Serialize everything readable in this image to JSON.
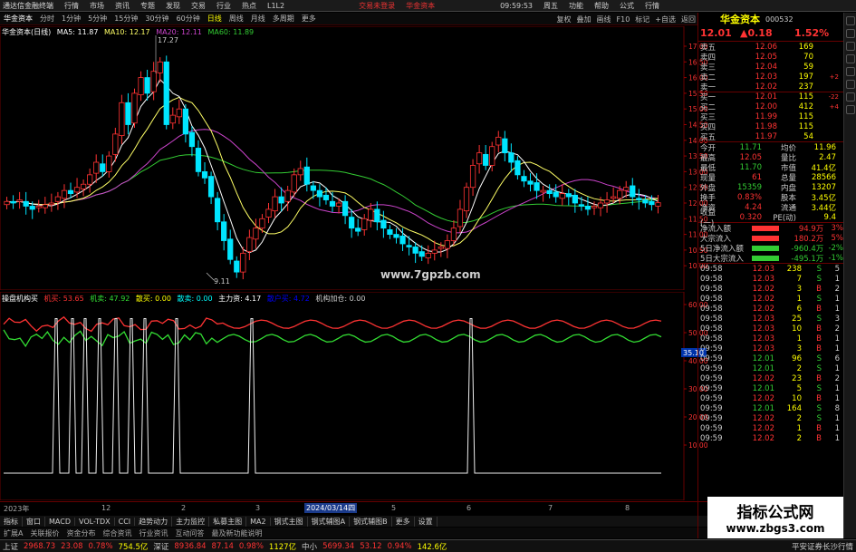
{
  "menubar": {
    "app": "通达信金融终端",
    "items": [
      "行情",
      "市场",
      "资讯",
      "专题",
      "发现",
      "交易",
      "行业",
      "热点",
      "L1L2"
    ],
    "right_red": [
      "交易未登录",
      "华金资本"
    ],
    "right": [
      "功能",
      "帮助",
      "公式",
      "行情"
    ],
    "time": "09:59:53",
    "day": "周五"
  },
  "toolbar": {
    "name": "华金资本",
    "periods": [
      "分时",
      "1分钟",
      "5分钟",
      "15分钟",
      "30分钟",
      "60分钟",
      "日线",
      "周线",
      "月线",
      "多周期",
      "更多"
    ],
    "active_period": "日线",
    "right": [
      "复权",
      "叠加",
      "画线",
      "F10",
      "标记",
      "+自选",
      "返回"
    ]
  },
  "main": {
    "title": "华金资本(日线)",
    "ma5": "MA5: 11.87",
    "ma10": "MA10: 12.17",
    "ma20": "MA20: 12.11",
    "ma60": "MA60: 11.89",
    "high_label": "17.27",
    "low_label": "9.11",
    "watermark": "www.7gpzb.com",
    "yaxis": [
      "17.00",
      "16.50",
      "16.00",
      "15.50",
      "15.00",
      "14.50",
      "14.00",
      "13.50",
      "13.00",
      "12.50",
      "12.00",
      "11.50",
      "11.00",
      "10.50",
      "10.00"
    ]
  },
  "indicator": {
    "title": "操盘机构买",
    "l1": "机买: 53.65",
    "l2": "机卖: 47.92",
    "l3": "散买: 0.00",
    "l4": "散卖: 0.00",
    "l5": "主力资: 4.17",
    "l6": "散户买: 4.72",
    "l7": "机构加仓: 0.00",
    "yaxis": [
      "60.00",
      "50.00",
      "40.00",
      "30.00",
      "20.00",
      "10.00"
    ],
    "marker": "35.10"
  },
  "xaxis": {
    "labels": [
      "2023年",
      "12",
      "2",
      "3",
      "2024/03/14四",
      "5",
      "6",
      "7",
      "8"
    ]
  },
  "tabs": [
    "指标",
    "窗口",
    "MACD",
    "VOL-TDX",
    "CCI",
    "趋势动力",
    "主力监控",
    "私募主图",
    "MA2",
    "钢式主图",
    "钢式辅图A",
    "钢式辅图B",
    "更多",
    "设置"
  ],
  "subtabs": [
    "扩展A",
    "关联报价",
    "资金分布",
    "综合资讯",
    "行业资讯",
    "互动问答",
    "最及新功能说明"
  ],
  "status": {
    "sh_label": "上证",
    "sh": "2968.73",
    "sh_ch": "23.08",
    "sh_pct": "0.78%",
    "sh_amt": "754.5亿",
    "sz_label": "深证",
    "sz": "8936.84",
    "sz_ch": "87.14",
    "sz_pct": "0.98%",
    "sz_amt": "1127亿",
    "zx_label": "中小",
    "zx": "5699.34",
    "zx_ch": "53.12",
    "zx_pct": "0.94%",
    "zx_amt": "142.6亿",
    "right": "平安证券长沙行情"
  },
  "quote": {
    "name": "华金资本",
    "code": "000532",
    "price": "12.01",
    "change": "▲0.18",
    "pct": "1.52%"
  },
  "orderbook": [
    {
      "label": "卖五",
      "price": "12.06",
      "vol": "169",
      "x": ""
    },
    {
      "label": "卖四",
      "price": "12.05",
      "vol": "70",
      "x": ""
    },
    {
      "label": "卖三",
      "price": "12.04",
      "vol": "59",
      "x": ""
    },
    {
      "label": "卖二",
      "price": "12.03",
      "vol": "197",
      "x": "+2"
    },
    {
      "label": "卖一",
      "price": "12.02",
      "vol": "237",
      "x": ""
    },
    {
      "label": "买一",
      "price": "12.01",
      "vol": "115",
      "x": "-22"
    },
    {
      "label": "买二",
      "price": "12.00",
      "vol": "412",
      "x": "+4"
    },
    {
      "label": "买三",
      "price": "11.99",
      "vol": "115",
      "x": ""
    },
    {
      "label": "买四",
      "price": "11.98",
      "vol": "115",
      "x": ""
    },
    {
      "label": "买五",
      "price": "11.97",
      "vol": "54",
      "x": ""
    }
  ],
  "stats": [
    {
      "l1": "今开",
      "v1": "11.71",
      "l2": "均价",
      "v2": "11.96"
    },
    {
      "l1": "最高",
      "v1": "12.05",
      "l2": "量比",
      "v2": "2.47"
    },
    {
      "l1": "最低",
      "v1": "11.70",
      "l2": "市值",
      "v2": "41.4亿"
    },
    {
      "l1": "现量",
      "v1": "61",
      "l2": "总量",
      "v2": "28566"
    },
    {
      "l1": "外盘",
      "v1": "15359",
      "l2": "内盘",
      "v2": "13207"
    },
    {
      "l1": "换手",
      "v1": "0.83%",
      "l2": "股本",
      "v2": "3.45亿"
    },
    {
      "l1": "净资",
      "v1": "4.24",
      "l2": "流通",
      "v2": "3.44亿"
    },
    {
      "l1": "收益(一)",
      "v1": "0.320",
      "l2": "PE(动)",
      "v2": "9.4"
    }
  ],
  "flows": [
    {
      "label": "净流入额",
      "value": "94.9万",
      "pct": "3%"
    },
    {
      "label": "大宗流入",
      "value": "180.2万",
      "pct": "5%"
    },
    {
      "label": "5日净流入额",
      "value": "-960.4万",
      "pct": "-2%"
    },
    {
      "label": "5日大宗流入",
      "value": "-495.1万",
      "pct": "-1%"
    }
  ],
  "ticks": [
    [
      "09:58",
      "12.03",
      "238",
      "S",
      "5"
    ],
    [
      "09:58",
      "12.03",
      "7",
      "S",
      "1"
    ],
    [
      "09:58",
      "12.02",
      "3",
      "B",
      "2"
    ],
    [
      "09:58",
      "12.02",
      "1",
      "S",
      "1"
    ],
    [
      "09:58",
      "12.02",
      "6",
      "B",
      "1"
    ],
    [
      "09:58",
      "12.03",
      "25",
      "S",
      "3"
    ],
    [
      "09:58",
      "12.03",
      "10",
      "B",
      "2"
    ],
    [
      "09:58",
      "12.03",
      "1",
      "B",
      "1"
    ],
    [
      "09:59",
      "12.03",
      "3",
      "B",
      "1"
    ],
    [
      "09:59",
      "12.01",
      "96",
      "S",
      "6"
    ],
    [
      "09:59",
      "12.01",
      "2",
      "S",
      "1"
    ],
    [
      "09:59",
      "12.02",
      "23",
      "B",
      "2"
    ],
    [
      "09:59",
      "12.01",
      "5",
      "S",
      "1"
    ],
    [
      "09:59",
      "12.02",
      "10",
      "B",
      "1"
    ],
    [
      "09:59",
      "12.01",
      "164",
      "S",
      "8"
    ],
    [
      "09:59",
      "12.02",
      "2",
      "S",
      "1"
    ],
    [
      "09:59",
      "12.02",
      "1",
      "B",
      "1"
    ],
    [
      "09:59",
      "12.02",
      "2",
      "B",
      "1"
    ]
  ],
  "watermark": {
    "line1": "指标公式网",
    "line2": "www.zbgs3.com"
  },
  "colors": {
    "up": "#ff3333",
    "down": "#00e5ff",
    "ma5": "#ffffff",
    "ma10": "#ffff66",
    "ma20": "#cc44cc",
    "ma60": "#33cc33"
  },
  "chart_data": {
    "type": "line",
    "title": "操盘机构买",
    "series": [
      {
        "name": "机买",
        "values": [
          53.65
        ]
      },
      {
        "name": "机卖",
        "values": [
          47.92
        ]
      },
      {
        "name": "散买",
        "values": [
          0,
          55,
          0,
          55,
          0,
          55,
          0,
          55,
          0,
          55,
          0,
          55,
          0,
          55,
          0,
          55,
          0,
          55,
          0,
          55,
          0,
          55,
          0
        ]
      }
    ],
    "ylim": [
      0,
      60
    ]
  }
}
